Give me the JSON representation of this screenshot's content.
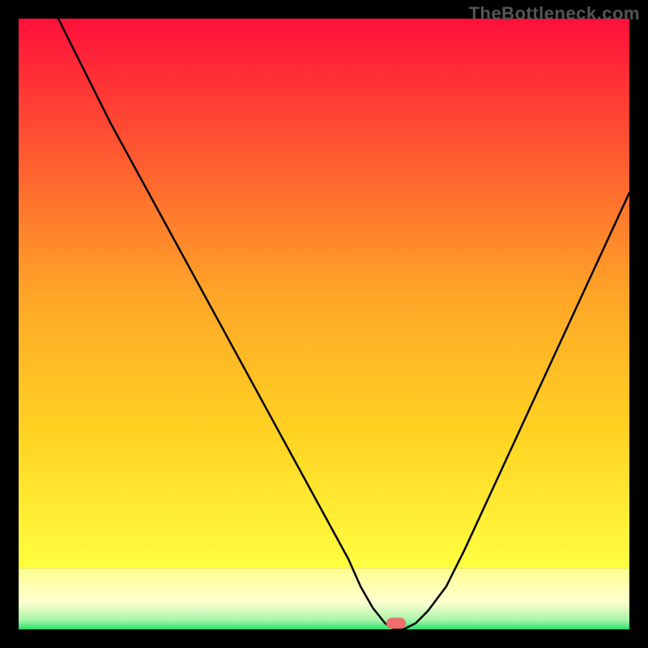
{
  "watermark": "TheBottleneck.com",
  "colors": {
    "background": "#000000",
    "curve": "#000000",
    "marker": "#ef6e6e",
    "gradient_top": [
      "#ff103a",
      "#ff5a30",
      "#ffa528",
      "#ffd222",
      "#ffff40"
    ],
    "gradient_bottom": [
      "#ffff90",
      "#ffffd0",
      "#a8f5a8",
      "#28e070"
    ]
  },
  "layout": {
    "outer": 800,
    "margin": 23,
    "inner": 754,
    "green_band_from_y_pct": 90
  },
  "chart_data": {
    "type": "line",
    "title": "",
    "xlabel": "",
    "ylabel": "",
    "xlim": [
      0,
      100
    ],
    "ylim": [
      0,
      100
    ],
    "x": [
      0,
      3,
      6,
      9,
      12,
      15,
      18,
      21,
      24,
      27,
      30,
      33,
      36,
      39,
      42,
      45,
      48,
      51,
      54,
      56,
      58,
      60,
      61.5,
      63,
      65,
      67,
      70,
      73,
      76,
      79,
      82,
      85,
      88,
      91,
      94,
      97,
      100
    ],
    "values": [
      113,
      107,
      101,
      95,
      89,
      83,
      77.5,
      72,
      66.5,
      61,
      55.5,
      50,
      44.5,
      39,
      33.5,
      28,
      22.5,
      17,
      11.5,
      7,
      3.5,
      1,
      0,
      0,
      1,
      3,
      7,
      13,
      19.5,
      26,
      32.5,
      39,
      45.5,
      52,
      58.5,
      65,
      71.5
    ],
    "note": "y is bottleneck percentage; 0 is best (bottom). Values >100 indicate the left branch begins above the visible area. x is relative hardware balance (arbitrary 0-100 scale).",
    "flat_min_x_range": [
      60,
      64
    ],
    "marker": {
      "x_pct": 61.8,
      "y_pct": 99.0,
      "w_pct": 3.2,
      "h_pct": 1.8
    }
  }
}
